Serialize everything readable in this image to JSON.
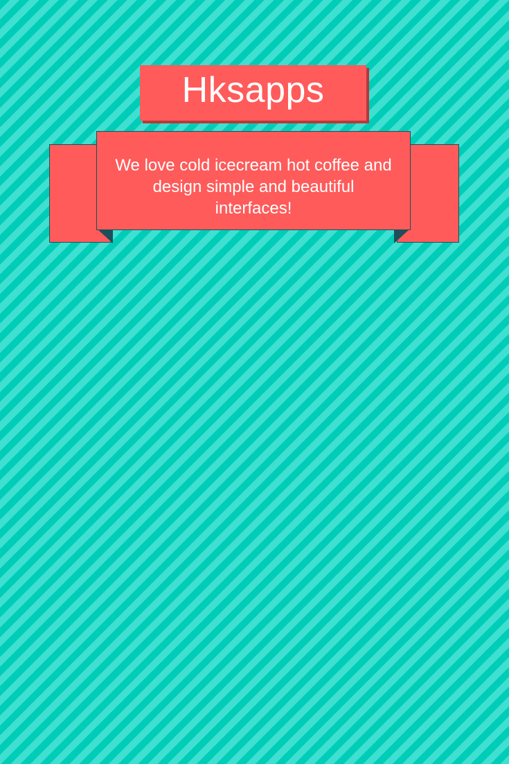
{
  "header": {
    "title": "Hksapps"
  },
  "ribbon": {
    "tagline": "We love cold icecream hot coffee and design simple and beautiful interfaces!"
  },
  "colors": {
    "background_stripe_dark": "#00cdb8",
    "background_stripe_light": "#3fe0d1",
    "accent": "#fe5b5a",
    "accent_shadow": "#b8383a",
    "ribbon_outline": "#1c4e5a",
    "text": "#ffffff"
  }
}
